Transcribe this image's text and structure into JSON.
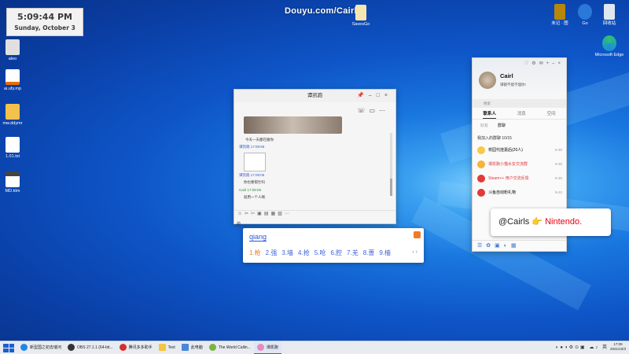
{
  "desktop": {
    "clock_widget": {
      "time": "5:09:44 PM",
      "date": "Sunday, October 3"
    },
    "watermark": "Douyu.com/Cairl",
    "icons_left": [
      {
        "label": "aleo",
        "icon": "file-icon"
      },
      {
        "label": "ai.ufy.mp",
        "icon": "java-icon"
      },
      {
        "label": "mw.ddymr",
        "icon": "archive-icon"
      },
      {
        "label": "1.01.txt",
        "icon": "text-file-icon"
      },
      {
        "label": "MD.ktm",
        "icon": "md-file-icon"
      }
    ],
    "icon_top_center": {
      "label": "SavesGo",
      "icon": "folder-file-icon"
    },
    "icons_right": [
      {
        "label": "未记 · 图",
        "icon": "book-icon"
      },
      {
        "label": "Go",
        "icon": "gear-icon"
      },
      {
        "label": "回收站",
        "icon": "recycle-bin-icon"
      },
      {
        "label": "Microsoft Edge",
        "icon": "edge-icon"
      }
    ]
  },
  "chat_window": {
    "title": "谭凯跑",
    "messages": [
      {
        "text": "今天一天都在搬你"
      },
      {
        "text": "谭凯跑  17:09:59",
        "user": true
      },
      {
        "text": "谭凯跑  17:09:06",
        "user": true
      },
      {
        "text": "你也要帮忙吗"
      },
      {
        "text": "Cairl  17:09:09",
        "self": true
      },
      {
        "text": "就用一个人啊"
      }
    ],
    "input_text": "护"
  },
  "ime": {
    "pinyin": "qiang",
    "candidates": [
      "1.枪",
      "2.强",
      "3.墙",
      "4.抢",
      "5.呛",
      "6.腔",
      "7.羌",
      "8.蔷",
      "9.樯"
    ],
    "selected_index": 0
  },
  "qq_panel": {
    "nickname": "Cairl",
    "signature": "谭都不能不理你!",
    "search_placeholder": "搜索",
    "tabs": [
      "联系人",
      "消息",
      "空间"
    ],
    "active_tab": 0,
    "sub_tabs": [
      "好友",
      "群聊"
    ],
    "group_header": "我加入的群聊  10/15",
    "groups": [
      {
        "name": "校园代挂嘉后(20人)",
        "time": "9-30",
        "color": "#f7c84a"
      },
      {
        "name": "谭凯跑小猫水友交流群",
        "time": "9-30",
        "color": "#f7b33a"
      },
      {
        "name": "Steam++ 用户交流反馈",
        "time": "9-30",
        "color": "#e03a3a"
      },
      {
        "name": "斗鱼自动粉礼物",
        "time": "9-22",
        "color": "#e03a3a"
      }
    ]
  },
  "overlay": {
    "handle": "@Cairls",
    "brand": "Nintendo."
  },
  "taskbar": {
    "tasks": [
      {
        "label": "新型国之初去瑞河",
        "color": "#1e88e5"
      },
      {
        "label": "OBS 27.1.1 (64-bit...",
        "color": "#333"
      },
      {
        "label": "腾讯多多助手",
        "color": "#d32f2f"
      },
      {
        "label": "Text",
        "color": "#f5c542"
      },
      {
        "label": "此电脑",
        "color": "#4a88d8"
      },
      {
        "label": "The World Callin...",
        "color": "#7cb342"
      },
      {
        "label": "谭凯跑",
        "color": "#e48bc0",
        "active": true
      }
    ],
    "time": "17:09",
    "date": "2021/10/3"
  }
}
